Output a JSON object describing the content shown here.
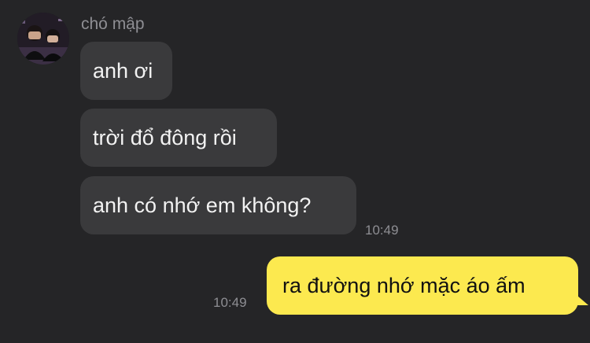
{
  "conversation": {
    "sender_name": "chó mập",
    "messages": [
      {
        "text": "anh ơi",
        "direction": "incoming"
      },
      {
        "text": "trời đổ đông rồi",
        "direction": "incoming"
      },
      {
        "text": "anh có nhớ em không?",
        "direction": "incoming",
        "time": "10:49"
      },
      {
        "text": "ra đường nhớ mặc áo ấm",
        "direction": "outgoing",
        "time": "10:49"
      }
    ]
  },
  "colors": {
    "background": "#252527",
    "incoming_bubble": "#3a3a3c",
    "outgoing_bubble": "#fce94f",
    "timestamp": "#8e8e93"
  }
}
